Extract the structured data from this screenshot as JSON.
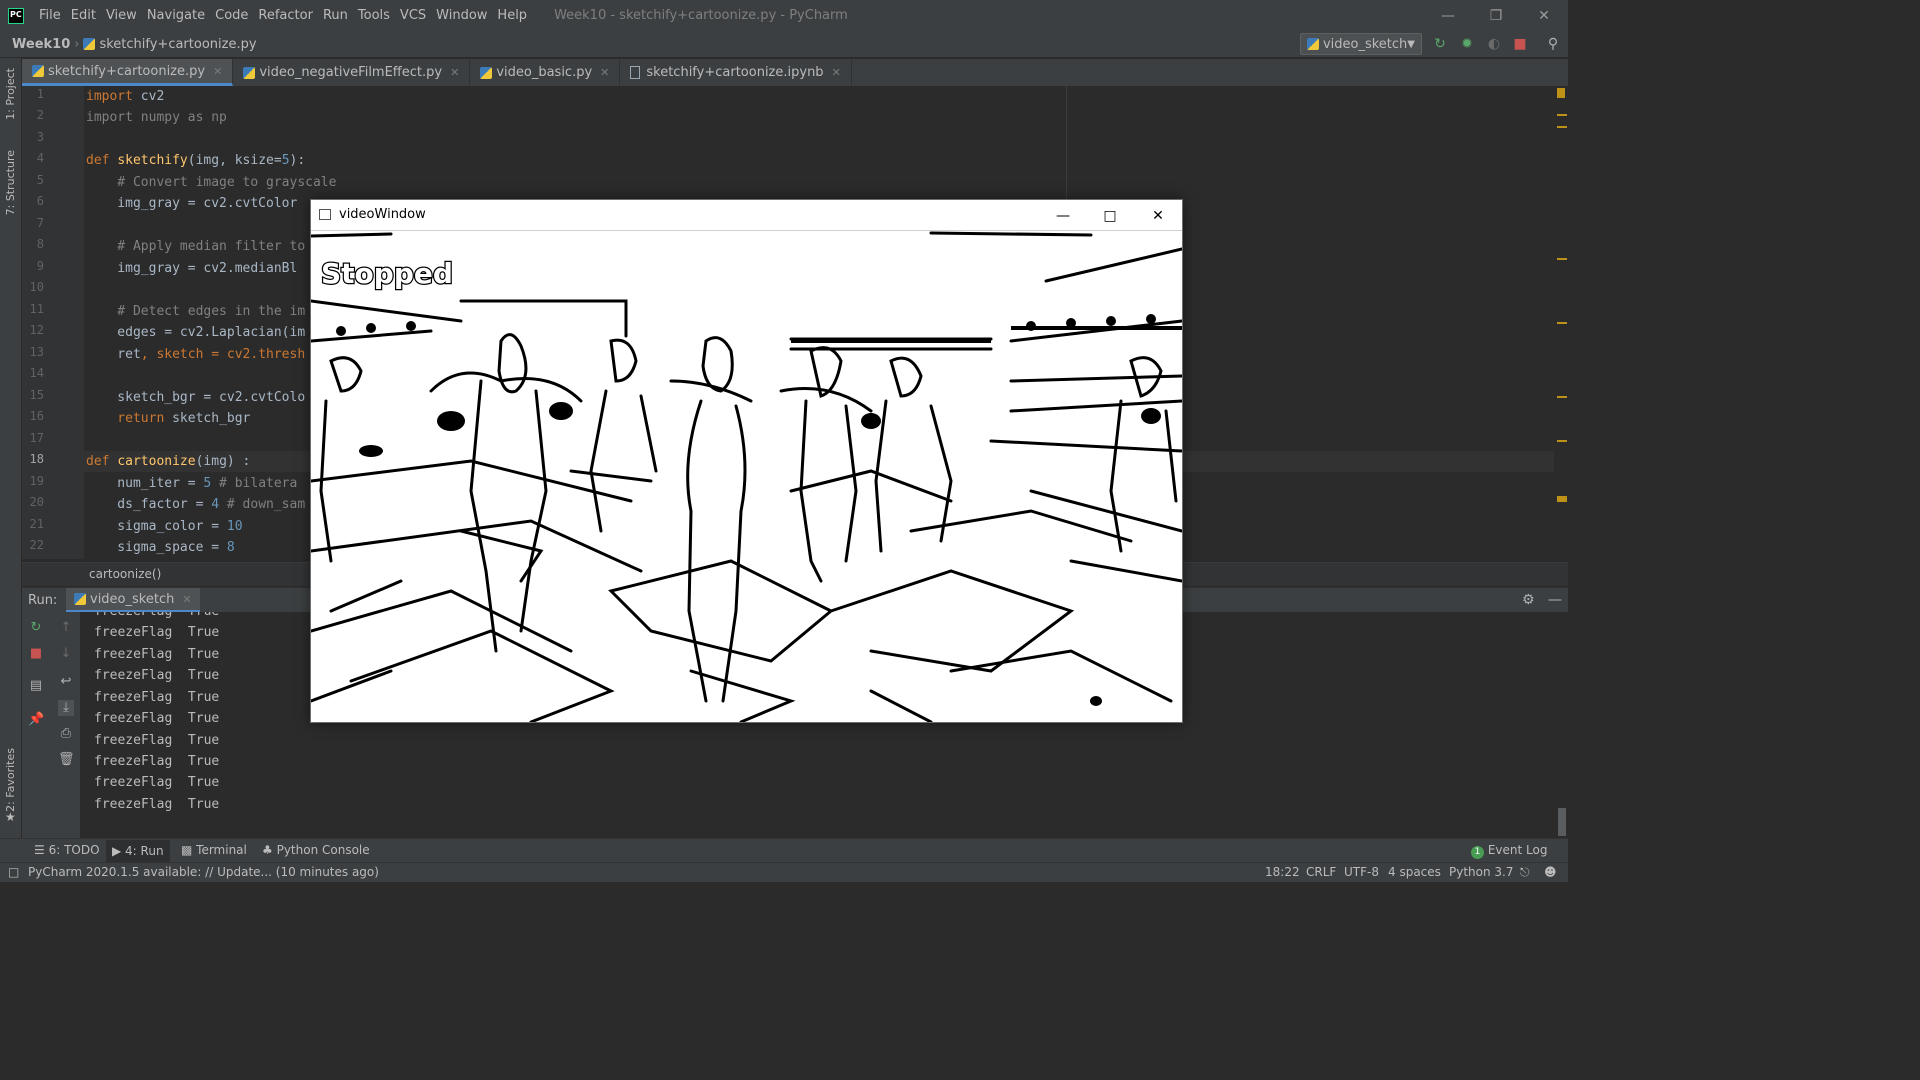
{
  "menubar": {
    "items": [
      "File",
      "Edit",
      "View",
      "Navigate",
      "Code",
      "Refactor",
      "Run",
      "Tools",
      "VCS",
      "Window",
      "Help"
    ],
    "title": "Week10 - sketchify+cartoonize.py - PyCharm"
  },
  "navbar": {
    "project": "Week10",
    "file": "sketchify+cartoonize.py",
    "run_config": "video_sketch"
  },
  "tabs": [
    {
      "label": "sketchify+cartoonize.py"
    },
    {
      "label": "video_negativeFilmEffect.py"
    },
    {
      "label": "video_basic.py"
    },
    {
      "label": "sketchify+cartoonize.ipynb"
    }
  ],
  "side_labels": {
    "project": "1: Project",
    "structure": "7: Structure",
    "favorites": "2: Favorites"
  },
  "editor": {
    "line_numbers": [
      "1",
      "2",
      "3",
      "4",
      "5",
      "6",
      "7",
      "8",
      "9",
      "10",
      "11",
      "12",
      "13",
      "14",
      "15",
      "16",
      "17",
      "18",
      "19",
      "20",
      "21",
      "22"
    ],
    "lines": {
      "l1_kw": "import",
      "l1_rest": " cv2",
      "l2": "import numpy as np",
      "l4_kw": "def",
      "l4_fn": "sketchify",
      "l4_a": "(img, ksize=",
      "l4_num": "5",
      "l4_b": "):",
      "l5": "    # Convert image to grayscale",
      "l6": "    img_gray = cv2.cvtColor",
      "l8": "    # Apply median filter to",
      "l9": "    img_gray = cv2.medianBl",
      "l11": "    # Detect edges in the im",
      "l12": "    edges = cv2.Laplacian(im",
      "l13_a": "    ret",
      "l13_b": ", sketch = cv2.thresh",
      "l15": "    sketch_bgr = cv2.cvtColo",
      "l16_kw": "    return",
      "l16_rest": " sketch_bgr",
      "l18_kw": "def",
      "l18_fn": "cartoonize",
      "l18_rest": "(img) :",
      "l19_a": "    num_iter = ",
      "l19_num": "5",
      "l19_cmt": " # bilatera",
      "l20_a": "    ds_factor = ",
      "l20_num": "4",
      "l20_cmt": " # down_sam",
      "l21_a": "    sigma_color = ",
      "l21_num": "10",
      "l22_a": "    sigma_space = ",
      "l22_num": "8"
    }
  },
  "breadcrumb": "cartoonize()",
  "run": {
    "label": "Run:",
    "tab": "video_sketch",
    "console_lines": [
      "freezeFlag  True",
      "freezeFlag  True",
      "freezeFlag  True",
      "freezeFlag  True",
      "freezeFlag  True",
      "freezeFlag  True",
      "freezeFlag  True",
      "freezeFlag  True",
      "freezeFlag  True",
      "freezeFlag  True"
    ]
  },
  "bottom_tools": {
    "todo": "6: TODO",
    "run": "4: Run",
    "terminal": "Terminal",
    "python_console": "Python Console",
    "event_log": "Event Log",
    "event_count": "1"
  },
  "status": {
    "message": "PyCharm 2020.1.5 available: // Update... (10 minutes ago)",
    "position": "18:22",
    "line_sep": "CRLF",
    "encoding": "UTF-8",
    "indent": "4 spaces",
    "interpreter": "Python 3.7"
  },
  "video_window": {
    "title": "videoWindow",
    "overlay_text": "Stopped"
  },
  "colors": {
    "keyword": "#cc7832",
    "function": "#ffc66d",
    "number": "#6897bb",
    "comment": "#808080",
    "accent": "#4a88c7"
  }
}
